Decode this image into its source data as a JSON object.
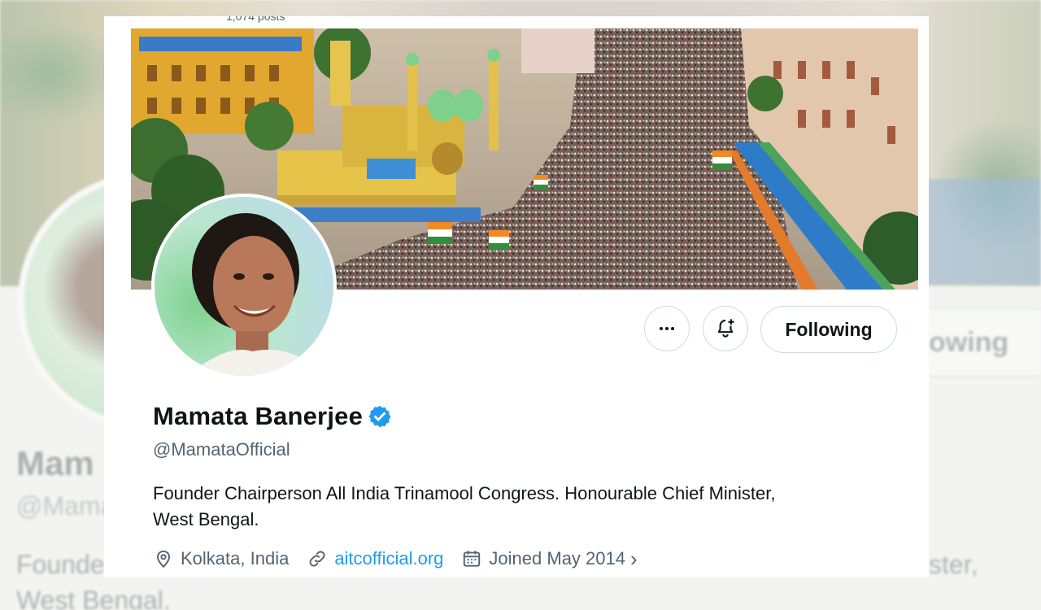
{
  "header": {
    "posts_count": "1,074 posts"
  },
  "profile": {
    "name": "Mamata Banerjee",
    "handle": "@MamataOfficial",
    "bio_line1": "Founder Chairperson All India Trinamool Congress. Honourable Chief Minister,",
    "bio_line2": "West Bengal.",
    "location": "Kolkata, India",
    "website": "aitcofficial.org",
    "joined": "Joined May 2014",
    "verified": true
  },
  "actions": {
    "more_icon": "more-icon",
    "notify_icon": "bell-plus-icon",
    "follow_label": "Following"
  },
  "backdrop": {
    "name": "Mam",
    "handle": "@Mama",
    "bio_left": "Founde",
    "bio_left2": "West Bengal.",
    "bio_right": "ster,",
    "follow_label": "owing"
  },
  "colors": {
    "accent": "#1d9bf0",
    "text": "#0f1419",
    "secondary": "#536471",
    "border": "#cfd9de"
  }
}
